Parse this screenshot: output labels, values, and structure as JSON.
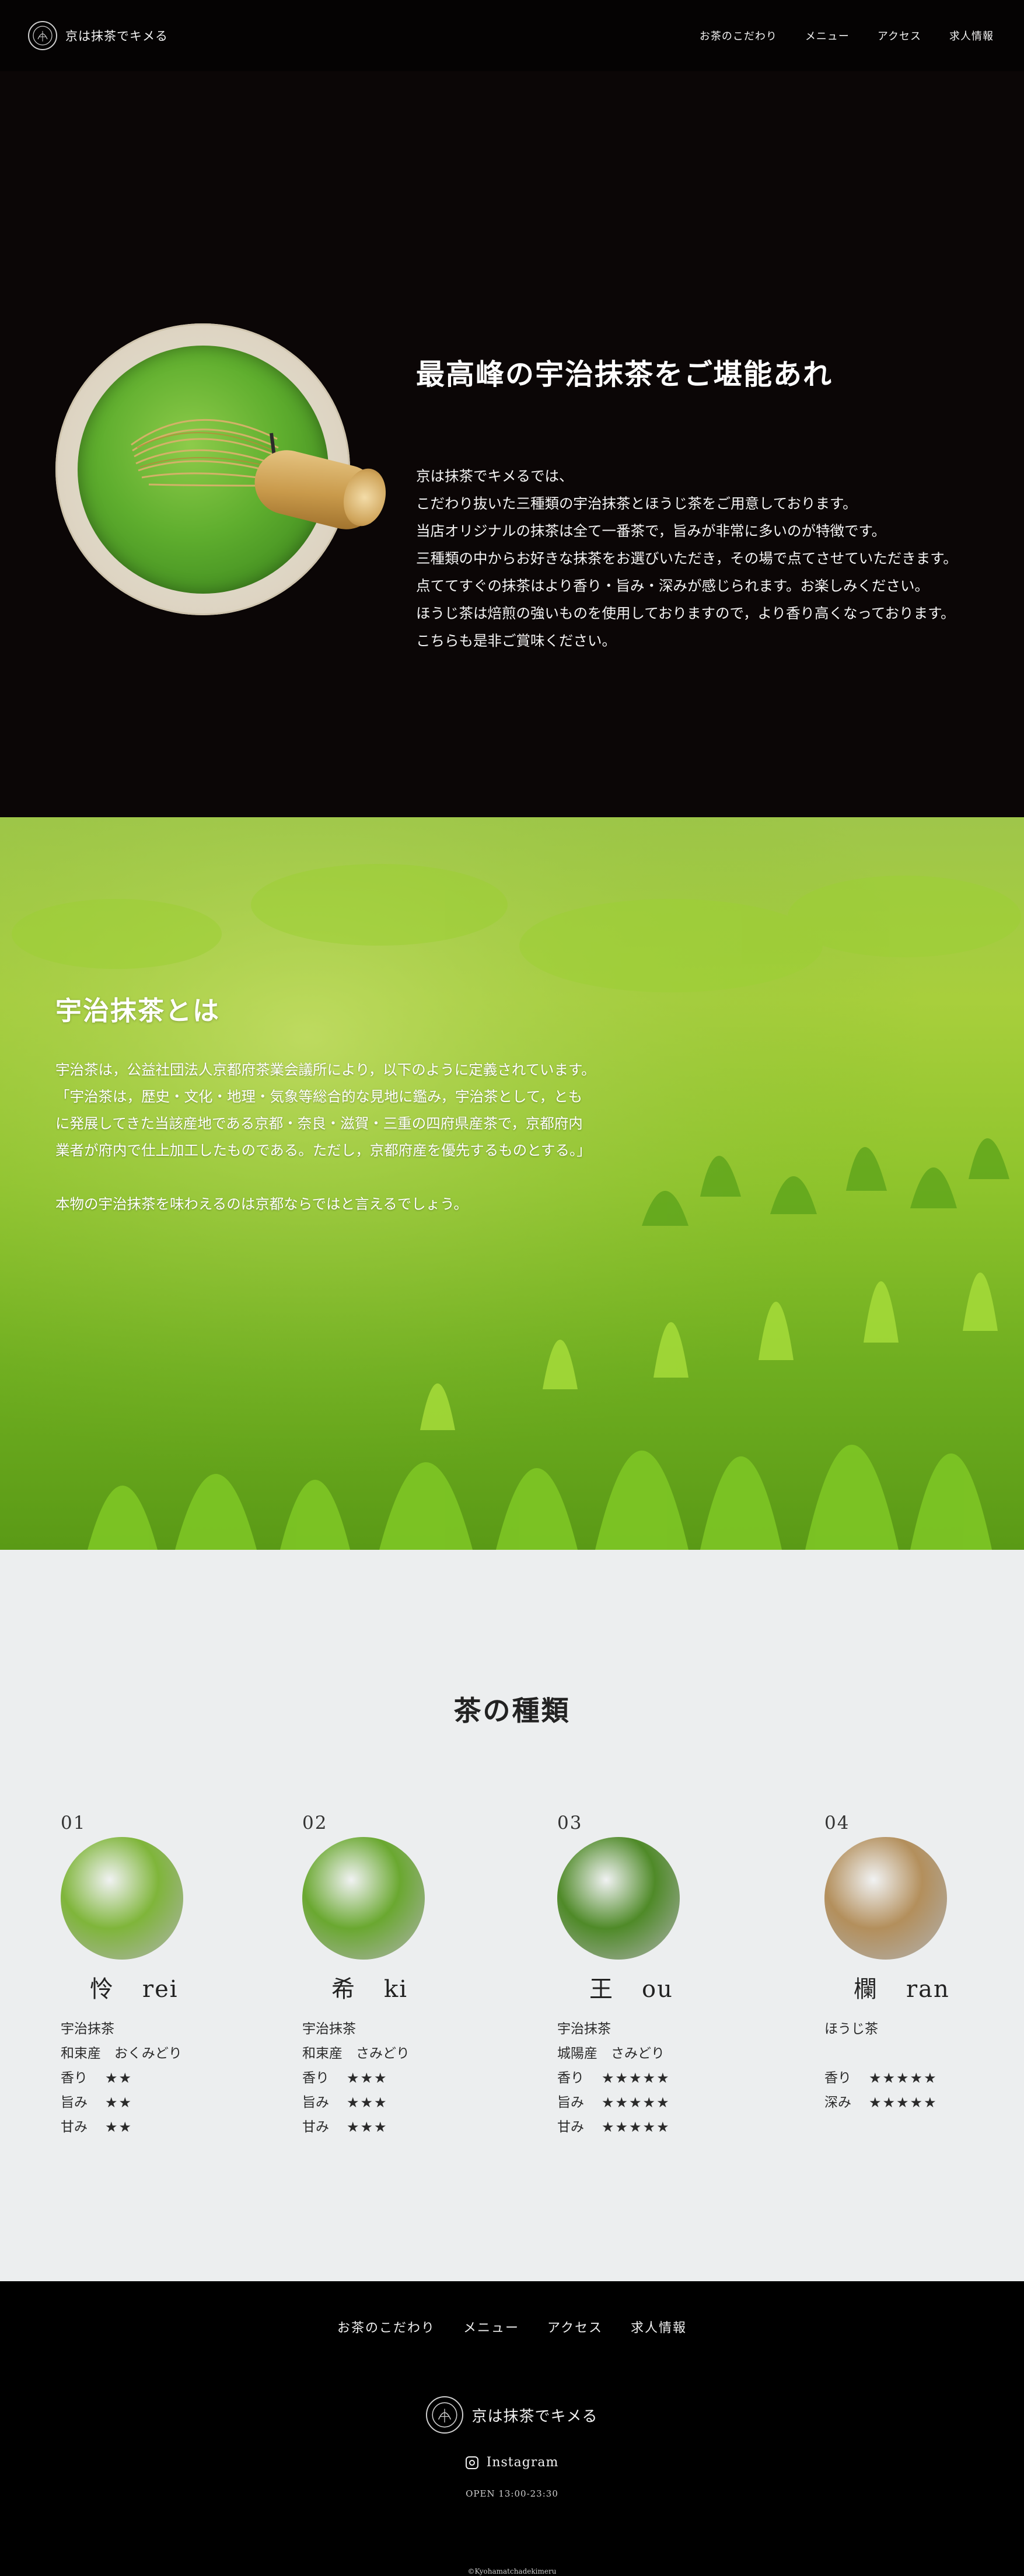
{
  "header": {
    "logo_text": "京は抹茶でキメる",
    "nav": [
      "お茶のこだわり",
      "メニュー",
      "アクセス",
      "求人情報"
    ]
  },
  "hero": {
    "title": "最高峰の宇治抹茶をご堪能あれ",
    "paragraphs": [
      "京は抹茶でキメるでは、",
      "こだわり抜いた三種類の宇治抹茶とほうじ茶をご用意しております。",
      "当店オリジナルの抹茶は全て一番茶で，旨みが非常に多いのが特徴です。",
      "三種類の中からお好きな抹茶をお選びいただき，その場で点てさせていただきます。",
      "点ててすぐの抹茶はより香り・旨み・深みが感じられます。お楽しみください。",
      "ほうじ茶は焙煎の強いものを使用しておりますので，より香り高くなっております。",
      "こちらも是非ご賞味ください。"
    ]
  },
  "uji": {
    "title": "宇治抹茶とは",
    "paragraphs": [
      "宇治茶は，公益社団法人京都府茶業会議所により，以下のように定義されています。",
      "「宇治茶は，歴史・文化・地理・気象等総合的な見地に鑑み，宇治茶として，とも",
      "に発展してきた当該産地である京都・奈良・滋賀・三重の四府県産茶で，京都府内",
      "業者が府内で仕上加工したものである。ただし，京都府産を優先するものとする。」"
    ],
    "closing": "本物の宇治抹茶を味わえるのは京都ならではと言えるでしょう。"
  },
  "types": {
    "title": "茶の種類",
    "cards": [
      {
        "num": "01",
        "kanji": "怜",
        "romaji": "rei",
        "color": "#7fb53a",
        "line1": "宇治抹茶",
        "line2": "和束産　おくみどり",
        "ratings": [
          {
            "label": "香り",
            "stars": "★★"
          },
          {
            "label": "旨み",
            "stars": "★★"
          },
          {
            "label": "甘み",
            "stars": "★★"
          }
        ]
      },
      {
        "num": "02",
        "kanji": "希",
        "romaji": "ki",
        "color": "#6aa830",
        "line1": "宇治抹茶",
        "line2": "和束産　さみどり",
        "ratings": [
          {
            "label": "香り",
            "stars": "★★★"
          },
          {
            "label": "旨み",
            "stars": "★★★"
          },
          {
            "label": "甘み",
            "stars": "★★★"
          }
        ]
      },
      {
        "num": "03",
        "kanji": "王",
        "romaji": "ou",
        "color": "#4f8a28",
        "line1": "宇治抹茶",
        "line2": "城陽産　さみどり",
        "ratings": [
          {
            "label": "香り",
            "stars": "★★★★★"
          },
          {
            "label": "旨み",
            "stars": "★★★★★"
          },
          {
            "label": "甘み",
            "stars": "★★★★★"
          }
        ]
      },
      {
        "num": "04",
        "kanji": "欄",
        "romaji": "ran",
        "color": "#b38f5c",
        "line1": "ほうじ茶",
        "line2": "",
        "ratings": [
          {
            "label": "香り",
            "stars": "★★★★★"
          },
          {
            "label": "深み",
            "stars": "★★★★★"
          }
        ]
      }
    ]
  },
  "footer": {
    "nav": [
      "お茶のこだわり",
      "メニュー",
      "アクセス",
      "求人情報"
    ],
    "logo_text": "京は抹茶でキメる",
    "instagram": "Instagram",
    "hours": "OPEN 13:00-23:30",
    "copyright": "©Kyohamatchadekimeru"
  }
}
